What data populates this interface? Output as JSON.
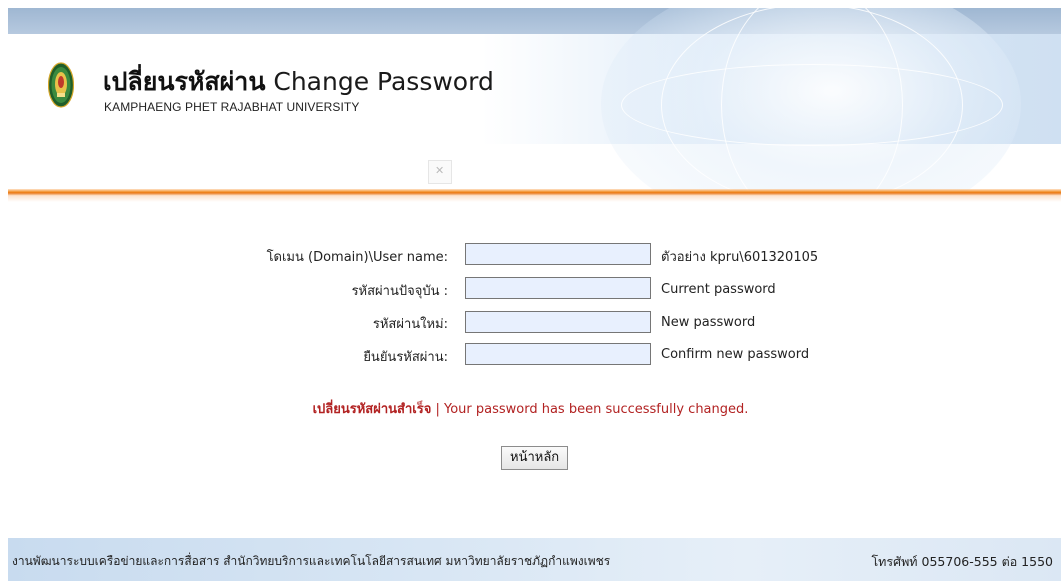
{
  "header": {
    "title_thai": "เปลี่ยนรหัสผ่าน",
    "title_en": "Change Password",
    "subtitle": "KAMPHAENG PHET RAJABHAT UNIVERSITY"
  },
  "form": {
    "username": {
      "label": "โดเมน (Domain)\\User name:",
      "value": "",
      "hint": "ตัวอย่าง kpru\\601320105"
    },
    "current_password": {
      "label": "รหัสผ่านปัจจุบัน :",
      "value": "",
      "hint": "Current password"
    },
    "new_password": {
      "label": "รหัสผ่านใหม่:",
      "value": "",
      "hint": "New password"
    },
    "confirm_password": {
      "label": "ยืนยันรหัสผ่าน:",
      "value": "",
      "hint": "Confirm new password"
    }
  },
  "message": {
    "thai": "เปลี่ยนรหัสผ่านสำเร็จ",
    "separator": " | ",
    "english": "Your password has been successfully changed."
  },
  "home_button_label": "หน้าหลัก",
  "footer": {
    "left": "งานพัฒนาระบบเครือข่ายและการสื่อสาร สำนักวิทยบริการและเทคโนโลยีสารสนเทศ มหาวิทยาลัยราชภัฏกำแพงเพชร",
    "right": "โทรศัพท์ 055706-555 ต่อ 1550"
  },
  "colors": {
    "accent_orange": "#f18a1e",
    "message_red": "#b22222",
    "input_bg": "#e8f0fe",
    "header_bar": "#9fb7d2"
  }
}
